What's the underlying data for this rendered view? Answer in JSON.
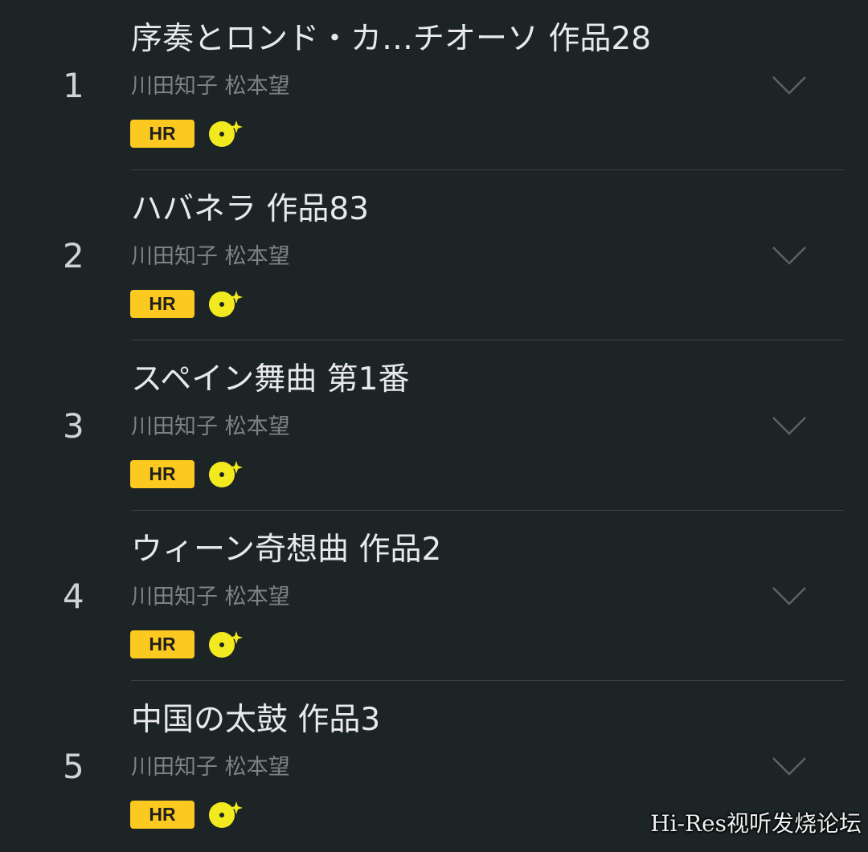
{
  "tracks": [
    {
      "number": "1",
      "title": "序奏とロンド・カ…チオーソ 作品28",
      "artist": "川田知子 松本望",
      "badge": "HR",
      "disc_icon": "disc-sparkle-icon",
      "expand_icon": "chevron-down-icon"
    },
    {
      "number": "2",
      "title": "ハバネラ 作品83",
      "artist": "川田知子 松本望",
      "badge": "HR",
      "disc_icon": "disc-sparkle-icon",
      "expand_icon": "chevron-down-icon"
    },
    {
      "number": "3",
      "title": "スペイン舞曲 第1番",
      "artist": "川田知子 松本望",
      "badge": "HR",
      "disc_icon": "disc-sparkle-icon",
      "expand_icon": "chevron-down-icon"
    },
    {
      "number": "4",
      "title": "ウィーン奇想曲 作品2",
      "artist": "川田知子 松本望",
      "badge": "HR",
      "disc_icon": "disc-sparkle-icon",
      "expand_icon": "chevron-down-icon"
    },
    {
      "number": "5",
      "title": "中国の太鼓 作品3",
      "artist": "川田知子 松本望",
      "badge": "HR",
      "disc_icon": "disc-sparkle-icon",
      "expand_icon": "chevron-down-icon"
    }
  ],
  "watermark": "Hi-Res视听发烧论坛",
  "colors": {
    "background": "#1d2426",
    "title": "#e7e9ea",
    "artist": "#7b8386",
    "badge": "#fbc91f",
    "disc": "#f2ea1f",
    "chevron": "#5a6366",
    "divider": "#3a4244"
  }
}
